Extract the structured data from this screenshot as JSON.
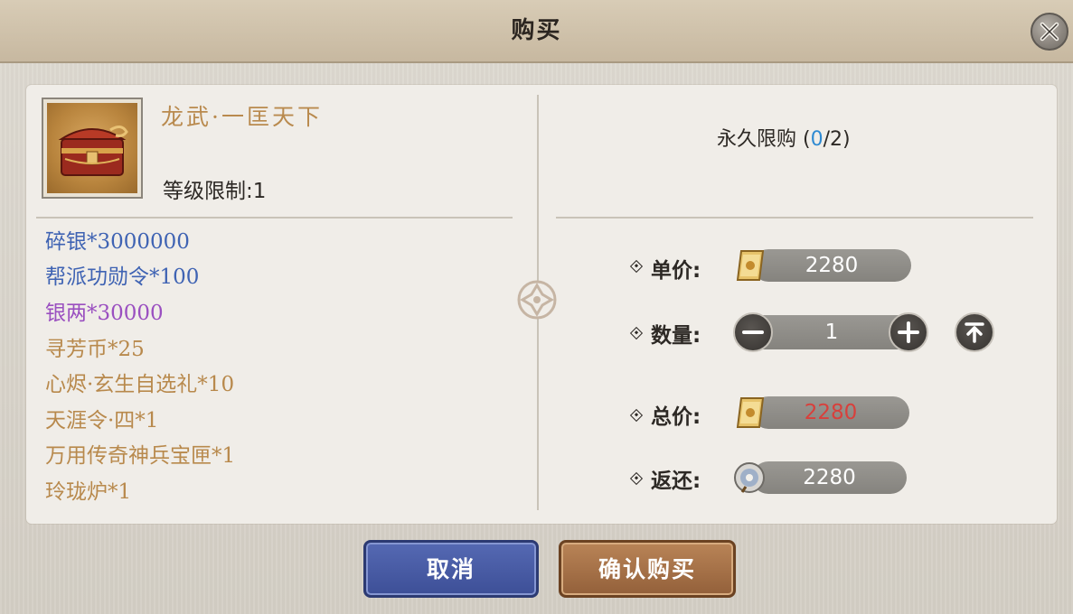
{
  "dialog": {
    "title": "购买",
    "close_icon": "close-icon"
  },
  "item": {
    "name": "龙武·一匡天下",
    "level_limit": "等级限制:1",
    "icon": "treasure-chest-icon"
  },
  "rewards": [
    {
      "text": "碎银*3000000",
      "color": "#3f63b3"
    },
    {
      "text": "帮派功勋令*100",
      "color": "#3f63b3"
    },
    {
      "text": "银两*30000",
      "color": "#9a4fc0"
    },
    {
      "text": "寻芳币*25",
      "color": "#b8894c"
    },
    {
      "text": "心烬·玄生自选礼*10",
      "color": "#b8894c"
    },
    {
      "text": "天涯令·四*1",
      "color": "#b8894c"
    },
    {
      "text": "万用传奇神兵宝匣*1",
      "color": "#b8894c"
    },
    {
      "text": "玲珑炉*1",
      "color": "#b8894c"
    }
  ],
  "limit": {
    "label": "永久限购 (",
    "current": "0",
    "suffix": "/2)"
  },
  "purchase": {
    "unit_price_label": "单价:",
    "unit_price": "2280",
    "quantity_label": "数量:",
    "quantity": "1",
    "total_label": "总价:",
    "total": "2280",
    "total_color": "#d8403c",
    "refund_label": "返还:",
    "refund": "2280",
    "currency_icon": "gold-ticket-icon",
    "refund_icon": "silver-coin-icon"
  },
  "buttons": {
    "cancel": "取消",
    "confirm": "确认购买"
  }
}
